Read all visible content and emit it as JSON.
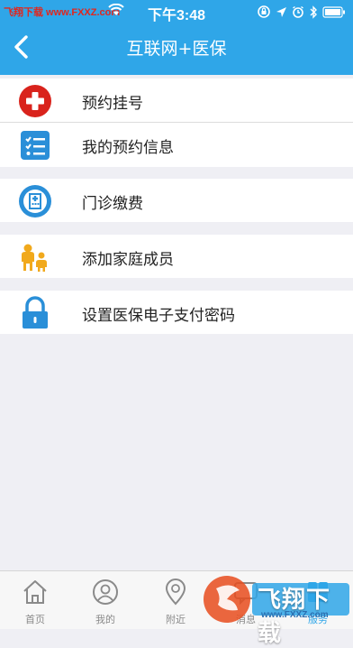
{
  "status_bar": {
    "carrier": "飞翔下载 www.FXXZ.com",
    "time": "下午3:48"
  },
  "nav": {
    "title": "互联网+医保",
    "back_icon": "chevron-left-icon"
  },
  "menu": [
    {
      "label": "预约挂号",
      "icon": "medical-cross-icon",
      "color": "#d9231c"
    },
    {
      "label": "我的预约信息",
      "icon": "checklist-icon",
      "color": "#2a8fd8"
    },
    {
      "label": "门诊缴费",
      "icon": "hospital-bill-icon",
      "color": "#2a8fd8"
    },
    {
      "label": "添加家庭成员",
      "icon": "family-icon",
      "color": "#f1a91c"
    },
    {
      "label": "设置医保电子支付密码",
      "icon": "lock-icon",
      "color": "#2a8fd8"
    }
  ],
  "tabbar": {
    "tabs": [
      {
        "label": "首页",
        "icon": "home-icon",
        "active": false
      },
      {
        "label": "我的",
        "icon": "user-icon",
        "active": false
      },
      {
        "label": "附近",
        "icon": "location-pin-icon",
        "active": false
      },
      {
        "label": "消息",
        "icon": "message-icon",
        "active": false
      },
      {
        "label": "服务",
        "icon": "service-icon",
        "active": true
      }
    ]
  },
  "watermark": {
    "text": "飞翔下载",
    "url": "www.FXXZ.com"
  },
  "colors": {
    "header": "#2fa6e8",
    "background": "#efeff4",
    "active_tab": "#2fa6e8"
  }
}
